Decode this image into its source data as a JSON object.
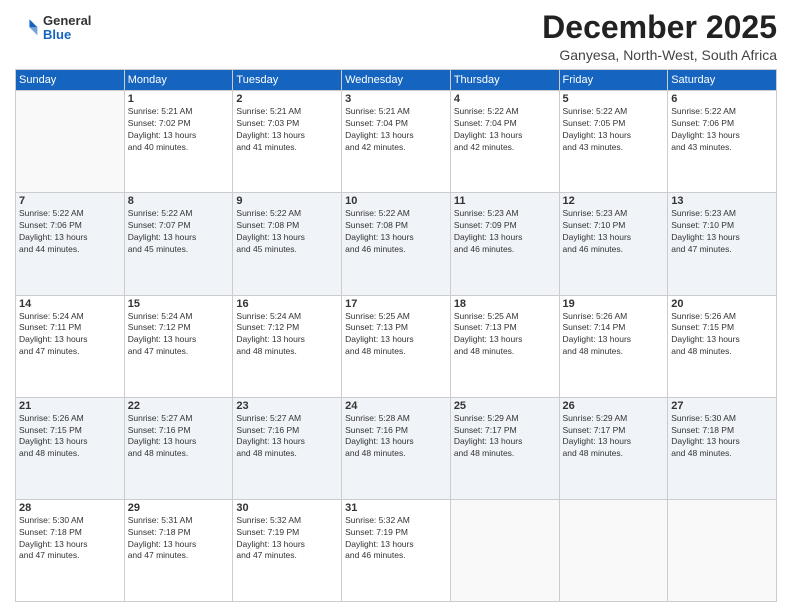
{
  "header": {
    "logo": {
      "general": "General",
      "blue": "Blue"
    },
    "title": "December 2025",
    "location": "Ganyesa, North-West, South Africa"
  },
  "calendar": {
    "days_of_week": [
      "Sunday",
      "Monday",
      "Tuesday",
      "Wednesday",
      "Thursday",
      "Friday",
      "Saturday"
    ],
    "weeks": [
      [
        {
          "day": "",
          "info": ""
        },
        {
          "day": "1",
          "info": "Sunrise: 5:21 AM\nSunset: 7:02 PM\nDaylight: 13 hours\nand 40 minutes."
        },
        {
          "day": "2",
          "info": "Sunrise: 5:21 AM\nSunset: 7:03 PM\nDaylight: 13 hours\nand 41 minutes."
        },
        {
          "day": "3",
          "info": "Sunrise: 5:21 AM\nSunset: 7:04 PM\nDaylight: 13 hours\nand 42 minutes."
        },
        {
          "day": "4",
          "info": "Sunrise: 5:22 AM\nSunset: 7:04 PM\nDaylight: 13 hours\nand 42 minutes."
        },
        {
          "day": "5",
          "info": "Sunrise: 5:22 AM\nSunset: 7:05 PM\nDaylight: 13 hours\nand 43 minutes."
        },
        {
          "day": "6",
          "info": "Sunrise: 5:22 AM\nSunset: 7:06 PM\nDaylight: 13 hours\nand 43 minutes."
        }
      ],
      [
        {
          "day": "7",
          "info": "Sunrise: 5:22 AM\nSunset: 7:06 PM\nDaylight: 13 hours\nand 44 minutes."
        },
        {
          "day": "8",
          "info": "Sunrise: 5:22 AM\nSunset: 7:07 PM\nDaylight: 13 hours\nand 45 minutes."
        },
        {
          "day": "9",
          "info": "Sunrise: 5:22 AM\nSunset: 7:08 PM\nDaylight: 13 hours\nand 45 minutes."
        },
        {
          "day": "10",
          "info": "Sunrise: 5:22 AM\nSunset: 7:08 PM\nDaylight: 13 hours\nand 46 minutes."
        },
        {
          "day": "11",
          "info": "Sunrise: 5:23 AM\nSunset: 7:09 PM\nDaylight: 13 hours\nand 46 minutes."
        },
        {
          "day": "12",
          "info": "Sunrise: 5:23 AM\nSunset: 7:10 PM\nDaylight: 13 hours\nand 46 minutes."
        },
        {
          "day": "13",
          "info": "Sunrise: 5:23 AM\nSunset: 7:10 PM\nDaylight: 13 hours\nand 47 minutes."
        }
      ],
      [
        {
          "day": "14",
          "info": "Sunrise: 5:24 AM\nSunset: 7:11 PM\nDaylight: 13 hours\nand 47 minutes."
        },
        {
          "day": "15",
          "info": "Sunrise: 5:24 AM\nSunset: 7:12 PM\nDaylight: 13 hours\nand 47 minutes."
        },
        {
          "day": "16",
          "info": "Sunrise: 5:24 AM\nSunset: 7:12 PM\nDaylight: 13 hours\nand 48 minutes."
        },
        {
          "day": "17",
          "info": "Sunrise: 5:25 AM\nSunset: 7:13 PM\nDaylight: 13 hours\nand 48 minutes."
        },
        {
          "day": "18",
          "info": "Sunrise: 5:25 AM\nSunset: 7:13 PM\nDaylight: 13 hours\nand 48 minutes."
        },
        {
          "day": "19",
          "info": "Sunrise: 5:26 AM\nSunset: 7:14 PM\nDaylight: 13 hours\nand 48 minutes."
        },
        {
          "day": "20",
          "info": "Sunrise: 5:26 AM\nSunset: 7:15 PM\nDaylight: 13 hours\nand 48 minutes."
        }
      ],
      [
        {
          "day": "21",
          "info": "Sunrise: 5:26 AM\nSunset: 7:15 PM\nDaylight: 13 hours\nand 48 minutes."
        },
        {
          "day": "22",
          "info": "Sunrise: 5:27 AM\nSunset: 7:16 PM\nDaylight: 13 hours\nand 48 minutes."
        },
        {
          "day": "23",
          "info": "Sunrise: 5:27 AM\nSunset: 7:16 PM\nDaylight: 13 hours\nand 48 minutes."
        },
        {
          "day": "24",
          "info": "Sunrise: 5:28 AM\nSunset: 7:16 PM\nDaylight: 13 hours\nand 48 minutes."
        },
        {
          "day": "25",
          "info": "Sunrise: 5:29 AM\nSunset: 7:17 PM\nDaylight: 13 hours\nand 48 minutes."
        },
        {
          "day": "26",
          "info": "Sunrise: 5:29 AM\nSunset: 7:17 PM\nDaylight: 13 hours\nand 48 minutes."
        },
        {
          "day": "27",
          "info": "Sunrise: 5:30 AM\nSunset: 7:18 PM\nDaylight: 13 hours\nand 48 minutes."
        }
      ],
      [
        {
          "day": "28",
          "info": "Sunrise: 5:30 AM\nSunset: 7:18 PM\nDaylight: 13 hours\nand 47 minutes."
        },
        {
          "day": "29",
          "info": "Sunrise: 5:31 AM\nSunset: 7:18 PM\nDaylight: 13 hours\nand 47 minutes."
        },
        {
          "day": "30",
          "info": "Sunrise: 5:32 AM\nSunset: 7:19 PM\nDaylight: 13 hours\nand 47 minutes."
        },
        {
          "day": "31",
          "info": "Sunrise: 5:32 AM\nSunset: 7:19 PM\nDaylight: 13 hours\nand 46 minutes."
        },
        {
          "day": "",
          "info": ""
        },
        {
          "day": "",
          "info": ""
        },
        {
          "day": "",
          "info": ""
        }
      ]
    ]
  }
}
